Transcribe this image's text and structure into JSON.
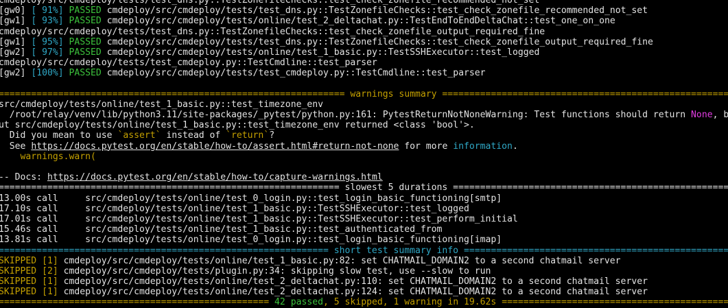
{
  "colors": {
    "background": "#000000",
    "text": "#e4e4e4",
    "passed": "#3cc23c",
    "progress": "#2fa8c6",
    "warning": "#c4a000",
    "magenta": "#e23ce2"
  },
  "lines": [
    {
      "name": "terminal-line",
      "segs": [
        {
          "t": "cmdeploy/src/cmdeploy/tests/test_dns.py::TestZonefileChecks::test_check_zonefile_recommended_not_set",
          "c": "white"
        }
      ]
    },
    {
      "name": "test-result-line",
      "segs": [
        {
          "t": "[gw0] ",
          "c": "white"
        },
        {
          "t": "[ 91%]",
          "c": "cyan"
        },
        {
          "t": " ",
          "c": "white"
        },
        {
          "t": "PASSED",
          "c": "green"
        },
        {
          "t": " cmdeploy/src/cmdeploy/tests/test_dns.py::TestZonefileChecks::test_check_zonefile_recommended_not_set",
          "c": "white"
        }
      ]
    },
    {
      "name": "test-result-line",
      "segs": [
        {
          "t": "[gw1] ",
          "c": "white"
        },
        {
          "t": "[ 93%]",
          "c": "cyan"
        },
        {
          "t": " ",
          "c": "white"
        },
        {
          "t": "PASSED",
          "c": "green"
        },
        {
          "t": " cmdeploy/src/cmdeploy/tests/online/test_2_deltachat.py::TestEndToEndDeltaChat::test_one_on_one",
          "c": "white"
        }
      ]
    },
    {
      "name": "terminal-line",
      "segs": [
        {
          "t": "cmdeploy/src/cmdeploy/tests/test_dns.py::TestZonefileChecks::test_check_zonefile_output_required_fine",
          "c": "white"
        }
      ]
    },
    {
      "name": "test-result-line",
      "segs": [
        {
          "t": "[gw1] ",
          "c": "white"
        },
        {
          "t": "[ 95%]",
          "c": "cyan"
        },
        {
          "t": " ",
          "c": "white"
        },
        {
          "t": "PASSED",
          "c": "green"
        },
        {
          "t": " cmdeploy/src/cmdeploy/tests/test_dns.py::TestZonefileChecks::test_check_zonefile_output_required_fine",
          "c": "white"
        }
      ]
    },
    {
      "name": "test-result-line",
      "segs": [
        {
          "t": "[gw2] ",
          "c": "white"
        },
        {
          "t": "[ 97%]",
          "c": "cyan"
        },
        {
          "t": " ",
          "c": "white"
        },
        {
          "t": "PASSED",
          "c": "green"
        },
        {
          "t": " cmdeploy/src/cmdeploy/tests/online/test_1_basic.py::TestSSHExecutor::test_logged",
          "c": "white"
        }
      ]
    },
    {
      "name": "terminal-line",
      "segs": [
        {
          "t": "cmdeploy/src/cmdeploy/tests/test_cmdeploy.py::TestCmdline::test_parser",
          "c": "white"
        }
      ]
    },
    {
      "name": "test-result-line",
      "segs": [
        {
          "t": "[gw2] ",
          "c": "white"
        },
        {
          "t": "[100%]",
          "c": "cyan"
        },
        {
          "t": " ",
          "c": "white"
        },
        {
          "t": "PASSED",
          "c": "green"
        },
        {
          "t": " cmdeploy/src/cmdeploy/tests/test_cmdeploy.py::TestCmdline::test_parser",
          "c": "white"
        }
      ]
    },
    {
      "name": "blank-line",
      "segs": [
        {
          "t": " ",
          "c": "white"
        }
      ]
    },
    {
      "name": "warnings-summary-header",
      "segs": [
        {
          "t": "================================================================ warnings summary ================================================================",
          "c": "yellow"
        }
      ]
    },
    {
      "name": "terminal-line",
      "segs": [
        {
          "t": "src/cmdeploy/tests/online/test_1_basic.py::test_timezone_env",
          "c": "white"
        }
      ]
    },
    {
      "name": "terminal-line",
      "segs": [
        {
          "t": "  /root/relay/venv/lib/python3.11/site-packages/_pytest/python.py:161: PytestReturnNotNoneWarning: Test functions should return ",
          "c": "white"
        },
        {
          "t": "None",
          "c": "magenta"
        },
        {
          "t": ", b",
          "c": "white"
        }
      ]
    },
    {
      "name": "terminal-line",
      "segs": [
        {
          "t": "ut src/cmdeploy/tests/online/test_1_basic.py::test_timezone_env returned <class 'bool'>.",
          "c": "white"
        }
      ]
    },
    {
      "name": "terminal-line",
      "segs": [
        {
          "t": "  Did you mean to use ",
          "c": "white"
        },
        {
          "t": "`assert`",
          "c": "yellow"
        },
        {
          "t": " instead of ",
          "c": "white"
        },
        {
          "t": "`return`",
          "c": "yellow"
        },
        {
          "t": "?",
          "c": "white"
        }
      ]
    },
    {
      "name": "terminal-line",
      "segs": [
        {
          "t": "  See ",
          "c": "white"
        },
        {
          "t": "https://docs.pytest.org/en/stable/how-to/assert.html#return-not-none",
          "c": "link",
          "name": "docs-link"
        },
        {
          "t": " for more ",
          "c": "white"
        },
        {
          "t": "information",
          "c": "cyan"
        },
        {
          "t": ".",
          "c": "white"
        }
      ]
    },
    {
      "name": "terminal-line",
      "segs": [
        {
          "t": "    warnings.warn(",
          "c": "yellow"
        }
      ]
    },
    {
      "name": "blank-line",
      "segs": [
        {
          "t": " ",
          "c": "white"
        }
      ]
    },
    {
      "name": "terminal-line",
      "segs": [
        {
          "t": "-- Docs: ",
          "c": "white"
        },
        {
          "t": "https://docs.pytest.org/en/stable/how-to/capture-warnings.html",
          "c": "link",
          "name": "docs-link"
        }
      ]
    },
    {
      "name": "slowest-durations-header",
      "segs": [
        {
          "t": "=============================================================== slowest 5 durations ===============================================================",
          "c": "white"
        }
      ]
    },
    {
      "name": "duration-line",
      "segs": [
        {
          "t": "13.00s call     src/cmdeploy/tests/online/test_0_login.py::test_login_basic_functioning[smtp]",
          "c": "white"
        }
      ]
    },
    {
      "name": "duration-line",
      "segs": [
        {
          "t": "17.10s call     src/cmdeploy/tests/online/test_1_basic.py::TestSSHExecutor::test_logged",
          "c": "white"
        }
      ]
    },
    {
      "name": "duration-line",
      "segs": [
        {
          "t": "17.01s call     src/cmdeploy/tests/online/test_1_basic.py::TestSSHExecutor::test_perform_initial",
          "c": "white"
        }
      ]
    },
    {
      "name": "duration-line",
      "segs": [
        {
          "t": "15.46s call     src/cmdeploy/tests/online/test_1_basic.py::test_authenticated_from",
          "c": "white"
        }
      ]
    },
    {
      "name": "duration-line",
      "segs": [
        {
          "t": "13.81s call     src/cmdeploy/tests/online/test_0_login.py::test_login_basic_functioning[imap]",
          "c": "white"
        }
      ]
    },
    {
      "name": "short-summary-header",
      "segs": [
        {
          "t": "============================================================= short test summary info =============================================================",
          "c": "cyan"
        }
      ]
    },
    {
      "name": "skipped-line",
      "segs": [
        {
          "t": "SKIPPED [1]",
          "c": "yellow"
        },
        {
          "t": " cmdeploy/src/cmdeploy/tests/online/test_1_basic.py:82: set CHATMAIL_DOMAIN2 to a second chatmail server",
          "c": "white"
        }
      ]
    },
    {
      "name": "skipped-line",
      "segs": [
        {
          "t": "SKIPPED [2]",
          "c": "yellow"
        },
        {
          "t": " cmdeploy/src/cmdeploy/tests/plugin.py:34: skipping slow test, use --slow to run",
          "c": "white"
        }
      ]
    },
    {
      "name": "skipped-line",
      "segs": [
        {
          "t": "SKIPPED [1]",
          "c": "yellow"
        },
        {
          "t": " cmdeploy/src/cmdeploy/tests/online/test_2_deltachat.py:110: set CHATMAIL_DOMAIN2 to a second chatmail server",
          "c": "white"
        }
      ]
    },
    {
      "name": "skipped-line",
      "segs": [
        {
          "t": "SKIPPED [1]",
          "c": "yellow"
        },
        {
          "t": " cmdeploy/src/cmdeploy/tests/online/test_2_deltachat.py:124: set CHATMAIL_DOMAIN2 to a second chatmail server",
          "c": "white"
        }
      ]
    },
    {
      "name": "final-summary-line",
      "segs": [
        {
          "t": "================================================== ",
          "c": "yellow"
        },
        {
          "t": "42 passed",
          "c": "green"
        },
        {
          "t": ", ",
          "c": "yellow"
        },
        {
          "t": "5 skipped",
          "c": "yellow"
        },
        {
          "t": ", ",
          "c": "yellow"
        },
        {
          "t": "1 warning",
          "c": "yellow"
        },
        {
          "t": " in 19.62s",
          "c": "yellow"
        },
        {
          "t": " ==================================================",
          "c": "yellow"
        }
      ]
    }
  ]
}
